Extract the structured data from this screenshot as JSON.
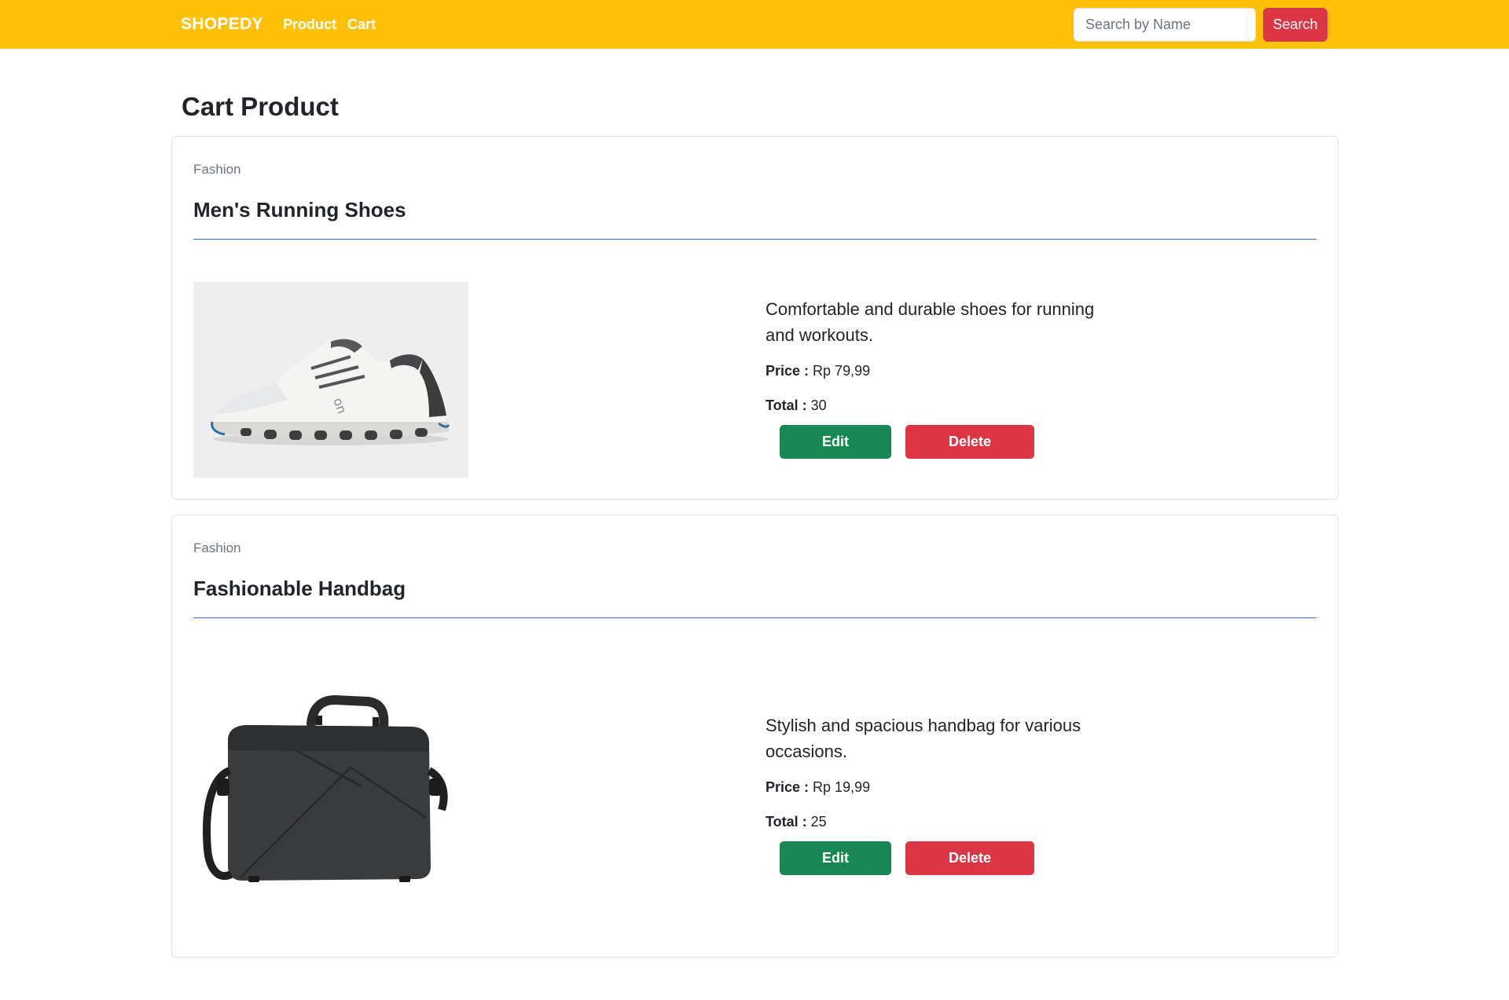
{
  "navbar": {
    "brand": "SHOPEDY",
    "links": [
      "Product",
      "Cart"
    ],
    "search_placeholder": "Search by Name",
    "search_button": "Search",
    "colors": {
      "navbar_bg": "#ffc107",
      "search_button_bg": "#dc3545"
    }
  },
  "page": {
    "title": "Cart Product"
  },
  "cart": [
    {
      "category": "Fashion",
      "name": "Men's Running Shoes",
      "image": "running-shoe",
      "description": "Comfortable and durable shoes for running and workouts.",
      "price_label": "Price :",
      "price": "Rp 79,99",
      "total_label": "Total :",
      "total": "30",
      "edit_label": "Edit",
      "delete_label": "Delete"
    },
    {
      "category": "Fashion",
      "name": "Fashionable Handbag",
      "image": "laptop-handbag",
      "description": "Stylish and spacious handbag for various occasions.",
      "price_label": "Price :",
      "price": "Rp 19,99",
      "total_label": "Total :",
      "total": "25",
      "edit_label": "Edit",
      "delete_label": "Delete"
    }
  ],
  "colors": {
    "edit_button": "#198754",
    "delete_button": "#dc3545",
    "divider": "#3d6fd1"
  }
}
